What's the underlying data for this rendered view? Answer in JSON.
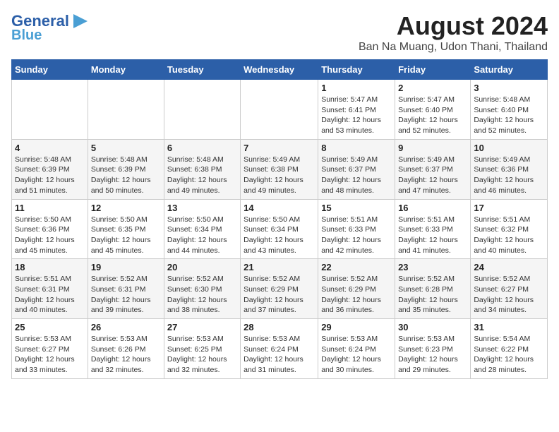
{
  "header": {
    "logo_line1": "General",
    "logo_line2": "Blue",
    "month_year": "August 2024",
    "location": "Ban Na Muang, Udon Thani, Thailand"
  },
  "weekdays": [
    "Sunday",
    "Monday",
    "Tuesday",
    "Wednesday",
    "Thursday",
    "Friday",
    "Saturday"
  ],
  "weeks": [
    [
      {
        "day": "",
        "info": ""
      },
      {
        "day": "",
        "info": ""
      },
      {
        "day": "",
        "info": ""
      },
      {
        "day": "",
        "info": ""
      },
      {
        "day": "1",
        "info": "Sunrise: 5:47 AM\nSunset: 6:41 PM\nDaylight: 12 hours\nand 53 minutes."
      },
      {
        "day": "2",
        "info": "Sunrise: 5:47 AM\nSunset: 6:40 PM\nDaylight: 12 hours\nand 52 minutes."
      },
      {
        "day": "3",
        "info": "Sunrise: 5:48 AM\nSunset: 6:40 PM\nDaylight: 12 hours\nand 52 minutes."
      }
    ],
    [
      {
        "day": "4",
        "info": "Sunrise: 5:48 AM\nSunset: 6:39 PM\nDaylight: 12 hours\nand 51 minutes."
      },
      {
        "day": "5",
        "info": "Sunrise: 5:48 AM\nSunset: 6:39 PM\nDaylight: 12 hours\nand 50 minutes."
      },
      {
        "day": "6",
        "info": "Sunrise: 5:48 AM\nSunset: 6:38 PM\nDaylight: 12 hours\nand 49 minutes."
      },
      {
        "day": "7",
        "info": "Sunrise: 5:49 AM\nSunset: 6:38 PM\nDaylight: 12 hours\nand 49 minutes."
      },
      {
        "day": "8",
        "info": "Sunrise: 5:49 AM\nSunset: 6:37 PM\nDaylight: 12 hours\nand 48 minutes."
      },
      {
        "day": "9",
        "info": "Sunrise: 5:49 AM\nSunset: 6:37 PM\nDaylight: 12 hours\nand 47 minutes."
      },
      {
        "day": "10",
        "info": "Sunrise: 5:49 AM\nSunset: 6:36 PM\nDaylight: 12 hours\nand 46 minutes."
      }
    ],
    [
      {
        "day": "11",
        "info": "Sunrise: 5:50 AM\nSunset: 6:36 PM\nDaylight: 12 hours\nand 45 minutes."
      },
      {
        "day": "12",
        "info": "Sunrise: 5:50 AM\nSunset: 6:35 PM\nDaylight: 12 hours\nand 45 minutes."
      },
      {
        "day": "13",
        "info": "Sunrise: 5:50 AM\nSunset: 6:34 PM\nDaylight: 12 hours\nand 44 minutes."
      },
      {
        "day": "14",
        "info": "Sunrise: 5:50 AM\nSunset: 6:34 PM\nDaylight: 12 hours\nand 43 minutes."
      },
      {
        "day": "15",
        "info": "Sunrise: 5:51 AM\nSunset: 6:33 PM\nDaylight: 12 hours\nand 42 minutes."
      },
      {
        "day": "16",
        "info": "Sunrise: 5:51 AM\nSunset: 6:33 PM\nDaylight: 12 hours\nand 41 minutes."
      },
      {
        "day": "17",
        "info": "Sunrise: 5:51 AM\nSunset: 6:32 PM\nDaylight: 12 hours\nand 40 minutes."
      }
    ],
    [
      {
        "day": "18",
        "info": "Sunrise: 5:51 AM\nSunset: 6:31 PM\nDaylight: 12 hours\nand 40 minutes."
      },
      {
        "day": "19",
        "info": "Sunrise: 5:52 AM\nSunset: 6:31 PM\nDaylight: 12 hours\nand 39 minutes."
      },
      {
        "day": "20",
        "info": "Sunrise: 5:52 AM\nSunset: 6:30 PM\nDaylight: 12 hours\nand 38 minutes."
      },
      {
        "day": "21",
        "info": "Sunrise: 5:52 AM\nSunset: 6:29 PM\nDaylight: 12 hours\nand 37 minutes."
      },
      {
        "day": "22",
        "info": "Sunrise: 5:52 AM\nSunset: 6:29 PM\nDaylight: 12 hours\nand 36 minutes."
      },
      {
        "day": "23",
        "info": "Sunrise: 5:52 AM\nSunset: 6:28 PM\nDaylight: 12 hours\nand 35 minutes."
      },
      {
        "day": "24",
        "info": "Sunrise: 5:52 AM\nSunset: 6:27 PM\nDaylight: 12 hours\nand 34 minutes."
      }
    ],
    [
      {
        "day": "25",
        "info": "Sunrise: 5:53 AM\nSunset: 6:27 PM\nDaylight: 12 hours\nand 33 minutes."
      },
      {
        "day": "26",
        "info": "Sunrise: 5:53 AM\nSunset: 6:26 PM\nDaylight: 12 hours\nand 32 minutes."
      },
      {
        "day": "27",
        "info": "Sunrise: 5:53 AM\nSunset: 6:25 PM\nDaylight: 12 hours\nand 32 minutes."
      },
      {
        "day": "28",
        "info": "Sunrise: 5:53 AM\nSunset: 6:24 PM\nDaylight: 12 hours\nand 31 minutes."
      },
      {
        "day": "29",
        "info": "Sunrise: 5:53 AM\nSunset: 6:24 PM\nDaylight: 12 hours\nand 30 minutes."
      },
      {
        "day": "30",
        "info": "Sunrise: 5:53 AM\nSunset: 6:23 PM\nDaylight: 12 hours\nand 29 minutes."
      },
      {
        "day": "31",
        "info": "Sunrise: 5:54 AM\nSunset: 6:22 PM\nDaylight: 12 hours\nand 28 minutes."
      }
    ]
  ]
}
